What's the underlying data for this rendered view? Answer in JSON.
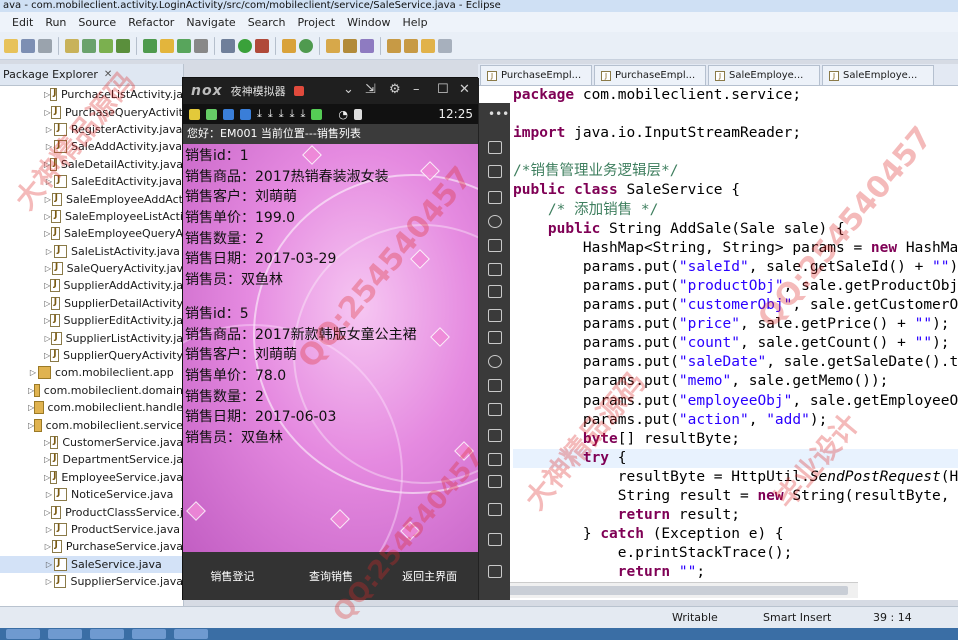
{
  "window": {
    "title": "ava - com.mobileclient.activity.LoginActivity/src/com/mobileclient/service/SaleService.java - Eclipse"
  },
  "menu": [
    "Edit",
    "Run",
    "Source",
    "Refactor",
    "Navigate",
    "Search",
    "Project",
    "Window",
    "Help"
  ],
  "package_explorer": {
    "title": "Package Explorer",
    "items": [
      {
        "label": "PurchaseListActivity.ja",
        "type": "file",
        "indent": 2
      },
      {
        "label": "PurchaseQueryActivit",
        "type": "file",
        "indent": 2
      },
      {
        "label": "RegisterActivity.java",
        "type": "file",
        "indent": 2
      },
      {
        "label": "SaleAddActivity.java",
        "type": "file",
        "indent": 2
      },
      {
        "label": "SaleDetailActivity.java",
        "type": "file",
        "indent": 2
      },
      {
        "label": "SaleEditActivity.java",
        "type": "file",
        "indent": 2
      },
      {
        "label": "SaleEmployeeAddAct",
        "type": "file",
        "indent": 2
      },
      {
        "label": "SaleEmployeeListActi",
        "type": "file",
        "indent": 2
      },
      {
        "label": "SaleEmployeeQueryA",
        "type": "file",
        "indent": 2
      },
      {
        "label": "SaleListActivity.java",
        "type": "file",
        "indent": 2
      },
      {
        "label": "SaleQueryActivity.jav",
        "type": "file",
        "indent": 2
      },
      {
        "label": "SupplierAddActivity.ja",
        "type": "file",
        "indent": 2
      },
      {
        "label": "SupplierDetailActivity",
        "type": "file",
        "indent": 2
      },
      {
        "label": "SupplierEditActivity.ja",
        "type": "file",
        "indent": 2
      },
      {
        "label": "SupplierListActivity.ja",
        "type": "file",
        "indent": 2
      },
      {
        "label": "SupplierQueryActivity",
        "type": "file",
        "indent": 2
      },
      {
        "label": "com.mobileclient.app",
        "type": "package",
        "indent": 1
      },
      {
        "label": "com.mobileclient.domain",
        "type": "package",
        "indent": 1
      },
      {
        "label": "com.mobileclient.handle",
        "type": "package",
        "indent": 1
      },
      {
        "label": "com.mobileclient.service",
        "type": "package",
        "indent": 1
      },
      {
        "label": "CustomerService.java",
        "type": "file",
        "indent": 2
      },
      {
        "label": "DepartmentService.ja",
        "type": "file",
        "indent": 2
      },
      {
        "label": "EmployeeService.java",
        "type": "file",
        "indent": 2
      },
      {
        "label": "NoticeService.java",
        "type": "file",
        "indent": 2
      },
      {
        "label": "ProductClassService.j",
        "type": "file",
        "indent": 2
      },
      {
        "label": "ProductService.java",
        "type": "file",
        "indent": 2
      },
      {
        "label": "PurchaseService.java",
        "type": "file",
        "indent": 2
      },
      {
        "label": "SaleService.java",
        "type": "file",
        "indent": 2,
        "selected": true
      },
      {
        "label": "SupplierService.java",
        "type": "file",
        "indent": 2
      }
    ]
  },
  "editor_tabs": [
    "PurchaseEmpl...",
    "PurchaseEmpl...",
    "SaleEmploye...",
    "SaleEmploye..."
  ],
  "code_lines": [
    [
      {
        "t": "package",
        "c": "kw"
      },
      {
        "t": " com.mobileclient.service;"
      }
    ],
    [
      {
        "t": ""
      }
    ],
    [
      {
        "t": "import",
        "c": "kw"
      },
      {
        "t": " java.io.InputStreamReader;"
      }
    ],
    [
      {
        "t": ""
      }
    ],
    [
      {
        "t": "/*销售管理业务逻辑层*/",
        "c": "cmt"
      }
    ],
    [
      {
        "t": "public class",
        "c": "kw"
      },
      {
        "t": " SaleService {"
      }
    ],
    [
      {
        "t": "    "
      },
      {
        "t": "/* 添加销售 */",
        "c": "cmt"
      }
    ],
    [
      {
        "t": "    "
      },
      {
        "t": "public",
        "c": "kw"
      },
      {
        "t": " String AddSale(Sale sale) {"
      }
    ],
    [
      {
        "t": "        HashMap<String, String> params = "
      },
      {
        "t": "new",
        "c": "kw"
      },
      {
        "t": " HashMa"
      }
    ],
    [
      {
        "t": "        params.put("
      },
      {
        "t": "\"saleId\"",
        "c": "str"
      },
      {
        "t": ", sale.getSaleId() + "
      },
      {
        "t": "\"\"",
        "c": "str"
      },
      {
        "t": ");"
      }
    ],
    [
      {
        "t": "        params.put("
      },
      {
        "t": "\"productObj\"",
        "c": "str"
      },
      {
        "t": ", sale.getProductObj"
      }
    ],
    [
      {
        "t": "        params.put("
      },
      {
        "t": "\"customerObj\"",
        "c": "str"
      },
      {
        "t": ", sale.getCustomerO"
      }
    ],
    [
      {
        "t": "        params.put("
      },
      {
        "t": "\"price\"",
        "c": "str"
      },
      {
        "t": ", sale.getPrice() + "
      },
      {
        "t": "\"\"",
        "c": "str"
      },
      {
        "t": ");"
      }
    ],
    [
      {
        "t": "        params.put("
      },
      {
        "t": "\"count\"",
        "c": "str"
      },
      {
        "t": ", sale.getCount() + "
      },
      {
        "t": "\"\"",
        "c": "str"
      },
      {
        "t": ");"
      }
    ],
    [
      {
        "t": "        params.put("
      },
      {
        "t": "\"saleDate\"",
        "c": "str"
      },
      {
        "t": ", sale.getSaleDate().t"
      }
    ],
    [
      {
        "t": "        params.put("
      },
      {
        "t": "\"memo\"",
        "c": "str"
      },
      {
        "t": ", sale.getMemo());"
      }
    ],
    [
      {
        "t": "        params.put("
      },
      {
        "t": "\"employeeObj\"",
        "c": "str"
      },
      {
        "t": ", sale.getEmployeeO"
      }
    ],
    [
      {
        "t": "        params.put("
      },
      {
        "t": "\"action\"",
        "c": "str"
      },
      {
        "t": ", "
      },
      {
        "t": "\"add\"",
        "c": "str"
      },
      {
        "t": ");"
      }
    ],
    [
      {
        "t": "        "
      },
      {
        "t": "byte",
        "c": "kw"
      },
      {
        "t": "[] resultByte;"
      }
    ],
    [
      {
        "t": "        "
      },
      {
        "t": "try",
        "c": "kw"
      },
      {
        "t": " {"
      }
    ],
    [
      {
        "t": "            resultByte = HttpUtil."
      },
      {
        "t": "SendPostRequest",
        "c": "it"
      },
      {
        "t": "(H"
      }
    ],
    [
      {
        "t": "            String result = "
      },
      {
        "t": "new",
        "c": "kw"
      },
      {
        "t": " String(resultByte,"
      }
    ],
    [
      {
        "t": "            "
      },
      {
        "t": "return",
        "c": "kw"
      },
      {
        "t": " result;"
      }
    ],
    [
      {
        "t": "        } "
      },
      {
        "t": "catch",
        "c": "kw"
      },
      {
        "t": " (Exception e) {"
      }
    ],
    [
      {
        "t": "            e.printStackTrace();"
      }
    ],
    [
      {
        "t": "            "
      },
      {
        "t": "return",
        "c": "kw"
      },
      {
        "t": " "
      },
      {
        "t": "\"\"",
        "c": "str"
      },
      {
        "t": ";"
      }
    ]
  ],
  "statusbar": {
    "writable": "Writable",
    "insert_mode": "Smart Insert",
    "position": "39 : 14"
  },
  "emulator": {
    "brand": "nox",
    "name": "夜神模拟器",
    "time": "12:25",
    "header": "您好：EM001  当前位置---销售列表",
    "records": [
      [
        "销售id：1",
        "销售商品：2017热销春装淑女装",
        "销售客户：刘萌萌",
        "销售单价：199.0",
        "销售数量：2",
        "销售日期：2017-03-29",
        "销售员：双鱼林"
      ],
      [
        "销售id：5",
        "销售商品：2017新款韩版女童公主裙",
        "销售客户：刘萌萌",
        "销售单价：78.0",
        "销售数量：2",
        "销售日期：2017-06-03",
        "销售员：双鱼林"
      ]
    ],
    "nav": [
      "销售登记",
      "查询销售",
      "返回主界面"
    ]
  },
  "watermark": {
    "text_a": "QQ:254540457",
    "text_b": "大神精品源码",
    "text_c": "毕业设计"
  },
  "colors": {
    "keyword": "#7f0055",
    "string": "#2a00ff",
    "comment": "#3f7f5f",
    "watermark": "#dc2828"
  }
}
